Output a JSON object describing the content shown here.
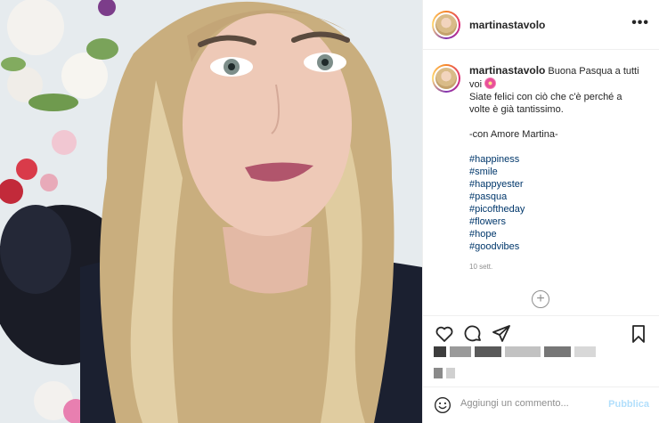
{
  "post": {
    "username": "martinastavolo",
    "more_label": "•••",
    "caption": {
      "username": "martinastavolo",
      "line1": "Buona Pasqua a tutti",
      "line2": "voi",
      "line3": "Siate felici con ciò che c'è perché a",
      "line4": "volte è già tantissimo.",
      "line5": "-con Amore Martina-"
    },
    "hashtags": [
      "#happiness",
      "#smile",
      "#happyester",
      "#pasqua",
      "#picoftheday",
      "#flowers",
      "#hope",
      "#goodvibes"
    ],
    "time": "10 sett."
  },
  "comment_bar": {
    "placeholder": "Aggiungi un commento...",
    "publish_label": "Pubblica"
  },
  "icons": [
    "heart-icon",
    "comment-icon",
    "share-icon",
    "bookmark-icon",
    "emoji-icon",
    "plus-circle-icon",
    "more-icon",
    "flower-emoji-icon"
  ],
  "colors": {
    "hashtag": "#00376b",
    "publish": "#b2dffc",
    "text": "#262626",
    "muted": "#8e8e8e"
  }
}
